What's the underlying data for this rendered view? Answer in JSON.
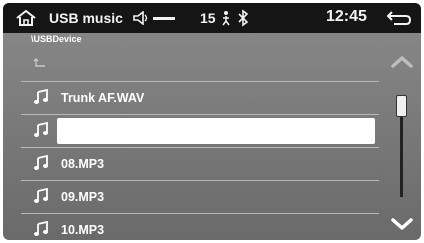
{
  "statusbar": {
    "source_label": "USB music",
    "volume_level": "15",
    "time": "12:45",
    "icons": [
      "home-icon",
      "speaker-icon",
      "person-icon",
      "bluetooth-icon",
      "back-icon"
    ]
  },
  "browser": {
    "path": "\\USBDevice",
    "items": [
      {
        "type": "folder-up",
        "label": ""
      },
      {
        "type": "music",
        "label": "Trunk AF.WAV"
      },
      {
        "type": "music",
        "label": "",
        "selected": true
      },
      {
        "type": "music",
        "label": "08.MP3"
      },
      {
        "type": "music",
        "label": "09.MP3"
      },
      {
        "type": "music",
        "label": "10.MP3"
      }
    ]
  },
  "colors": {
    "statusbar_bg": "#151515",
    "list_bg": "#7a7a7a",
    "text": "#ffffff",
    "highlight": "#ffffff"
  }
}
